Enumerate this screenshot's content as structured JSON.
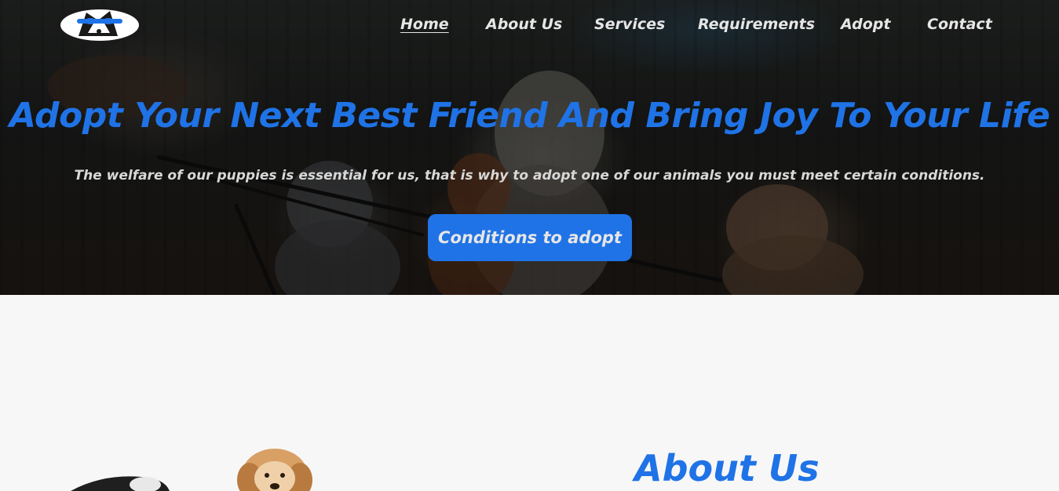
{
  "logo": {
    "icon": "husky-with-sunglasses-icon"
  },
  "nav": {
    "items": [
      {
        "label": "Home",
        "active": true
      },
      {
        "label": "About Us",
        "active": false
      },
      {
        "label": "Services",
        "active": false
      },
      {
        "label": "Requirements",
        "active": false
      },
      {
        "label": "Adopt",
        "active": false
      },
      {
        "label": "Contact",
        "active": false
      }
    ]
  },
  "hero": {
    "title": "Adopt Your Next Best Friend And Bring Joy To Your Life",
    "subtitle": "The welfare of our puppies is essential for us, that is why to adopt one of our animals you must meet certain conditions.",
    "cta_label": "Conditions to adopt"
  },
  "about": {
    "title": "About Us"
  },
  "colors": {
    "accent": "#1f73e6",
    "nav_text": "#e6e6e6",
    "section_bg": "#f7f7f7"
  }
}
